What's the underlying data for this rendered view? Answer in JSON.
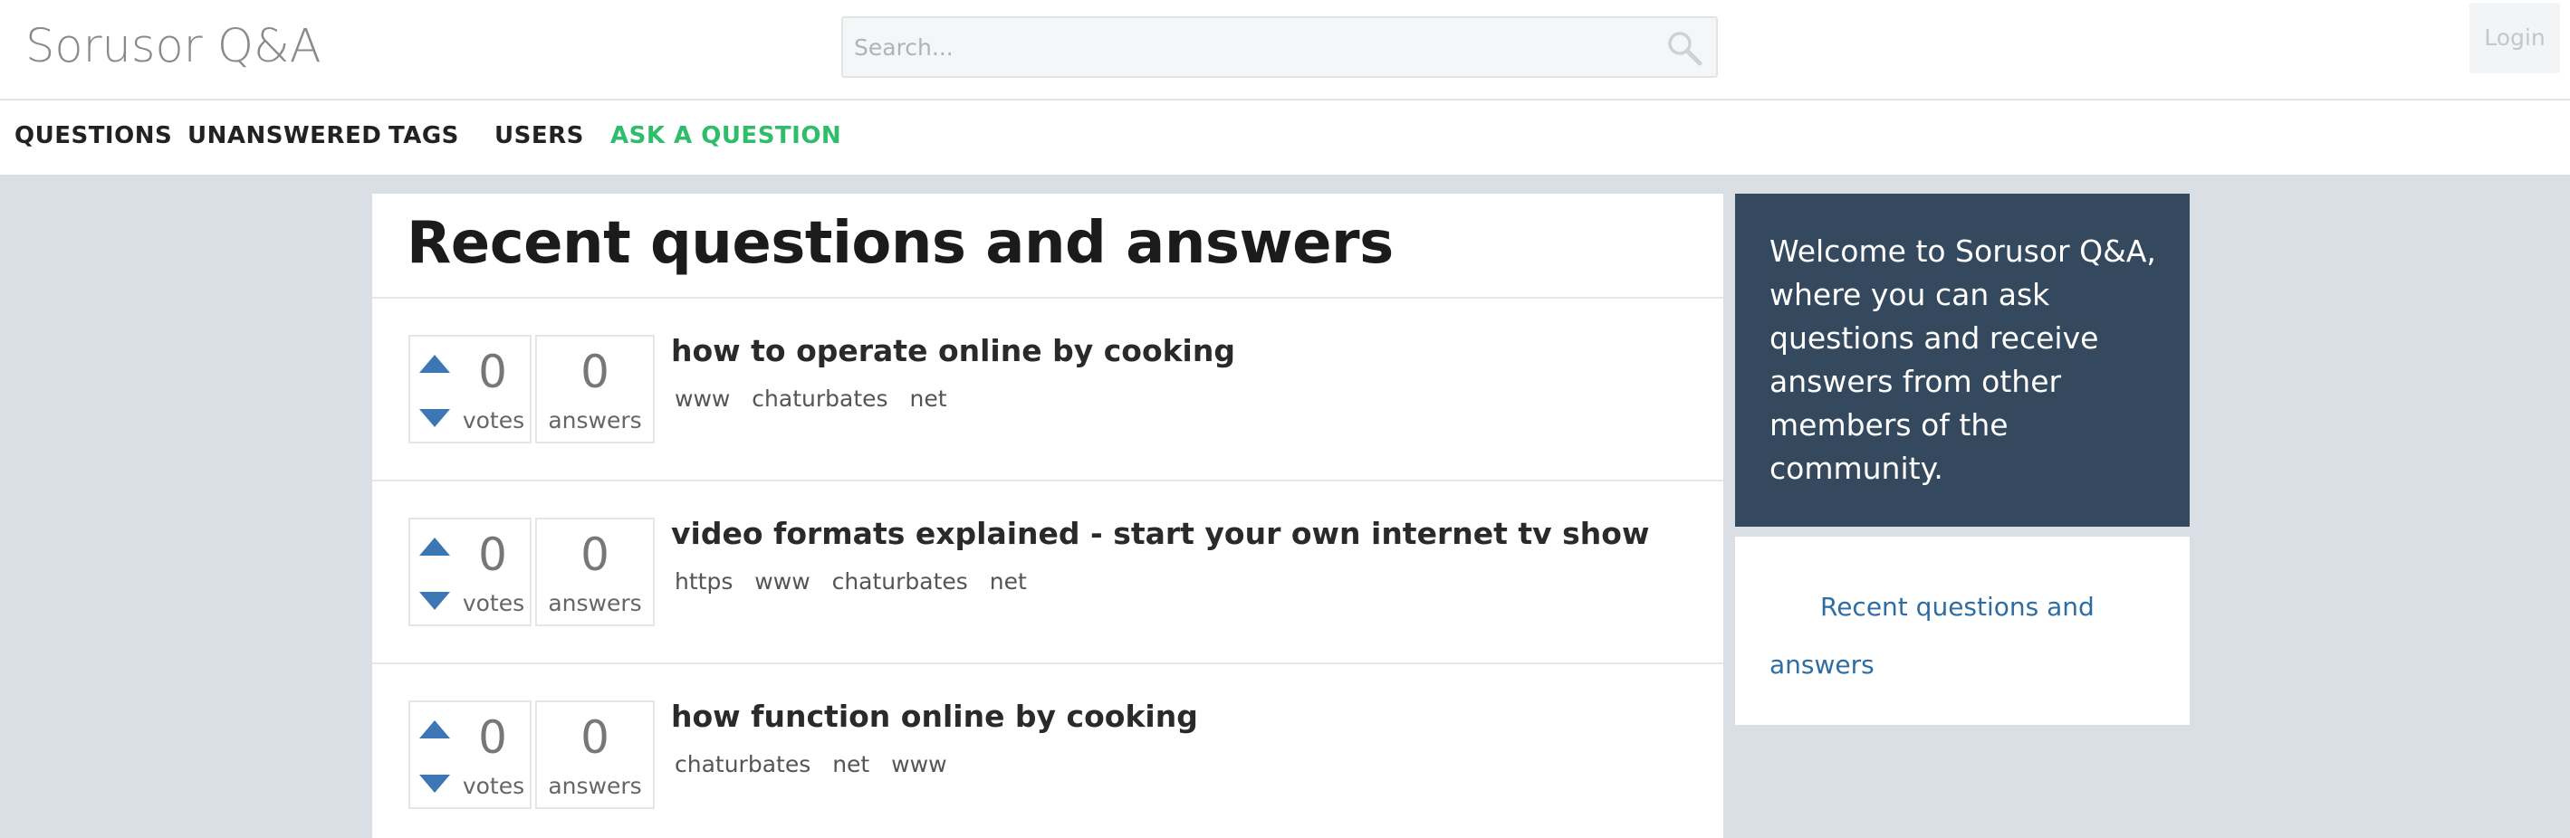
{
  "header": {
    "logo": "Sorusor Q&A",
    "search_placeholder": "Search...",
    "login_label": "Login"
  },
  "nav": {
    "items": [
      "QUESTIONS",
      "UNANSWERED",
      "TAGS",
      "USERS",
      "ASK A QUESTION"
    ]
  },
  "main": {
    "title": "Recent questions and answers",
    "questions": [
      {
        "title": "how to operate online by cooking",
        "votes": "0",
        "votes_label": "votes",
        "answers": "0",
        "answers_label": "answers",
        "tags": [
          "www",
          "chaturbates",
          "net"
        ]
      },
      {
        "title": "video formats explained - start your own internet tv show",
        "votes": "0",
        "votes_label": "votes",
        "answers": "0",
        "answers_label": "answers",
        "tags": [
          "https",
          "www",
          "chaturbates",
          "net"
        ]
      },
      {
        "title": "how function online by cooking",
        "votes": "0",
        "votes_label": "votes",
        "answers": "0",
        "answers_label": "answers",
        "tags": [
          "chaturbates",
          "net",
          "www"
        ]
      }
    ]
  },
  "sidebar": {
    "welcome": "Welcome to Sorusor Q&A, where you can ask questions and receive answers from other members of the community.",
    "link": "Recent questions and answers"
  },
  "colors": {
    "background": "#dadfe6",
    "ask_link": "#2ebd6b",
    "vote_arrow": "#3d76b5",
    "welcome_bg": "#34495e",
    "link": "#2e6da4"
  },
  "icons": {
    "search": "search-icon",
    "vote_up": "vote-up-icon",
    "vote_down": "vote-down-icon"
  }
}
